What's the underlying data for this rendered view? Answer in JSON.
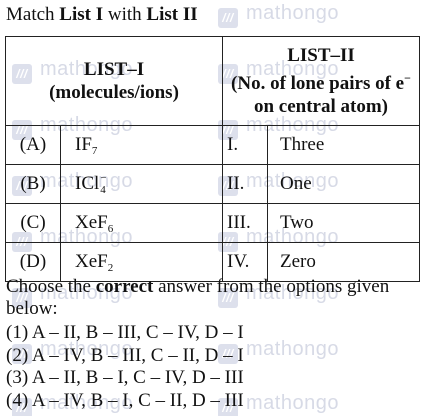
{
  "watermark": {
    "text": "mathongo",
    "logo_glyph": "///"
  },
  "question": {
    "prefix": "Match ",
    "list1": "List I",
    "mid": " with ",
    "list2": "List II"
  },
  "table": {
    "header1": {
      "line1": "LIST–I",
      "line2": "(molecules/ions)"
    },
    "header2": {
      "line1": "LIST–II",
      "line2": "(No. of lone pairs of e",
      "line2_sup": "−",
      "line3": "on central atom)"
    },
    "rows": [
      {
        "label": "(A)",
        "mol": "IF",
        "sub": "7",
        "roman": "I.",
        "value": "Three"
      },
      {
        "label": "(B)",
        "mol": "ICl",
        "sup": "−",
        "sub": "4",
        "roman": "II.",
        "value": "One"
      },
      {
        "label": "(C)",
        "mol": "XeF",
        "sub": "6",
        "roman": "III.",
        "value": "Two"
      },
      {
        "label": "(D)",
        "mol": "XeF",
        "sub": "2",
        "roman": "IV.",
        "value": "Zero"
      }
    ]
  },
  "instruction": {
    "prefix": "Choose the ",
    "bold": "correct",
    "suffix": " answer from the options given below:"
  },
  "options": [
    "(1) A – II, B – III, C – IV, D – I",
    "(2) A – IV, B – III, C – II, D – I",
    "(3) A – II, B – I, C – IV, D – III",
    "(4) A – IV, B – I, C – II, D – III"
  ]
}
